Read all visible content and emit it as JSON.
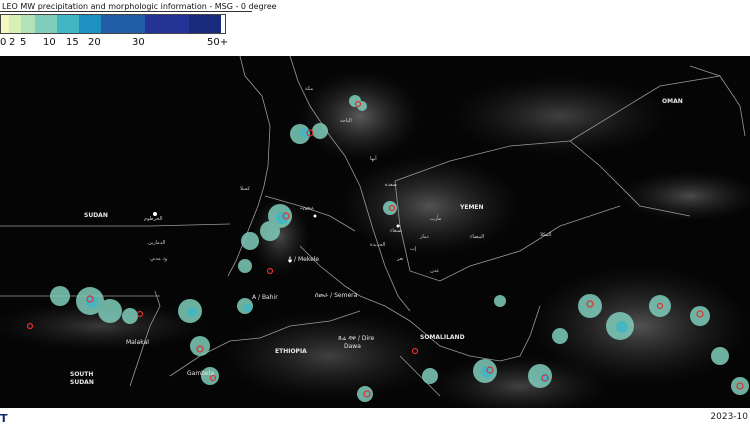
{
  "header": {
    "title": "LEO MW precipitation and morphologic information - MSG - 0 degree"
  },
  "legend": {
    "ticks": [
      "0",
      "2",
      "5",
      "10",
      "15",
      "20",
      "30",
      "50+"
    ],
    "colors": [
      "#f3f8c4",
      "#d8efb5",
      "#b2e2b8",
      "#7fcdbb",
      "#41b6c4",
      "#1d91c0",
      "#225ea8",
      "#253494",
      "#1a2a7a"
    ]
  },
  "map": {
    "countries": {
      "sudan": "SUDAN",
      "south_sudan_line1": "SOUTH",
      "south_sudan_line2": "SUDAN",
      "yemen": "YEMEN",
      "oman": "OMAN",
      "ethiopia": "ETHIOPIA",
      "somaliland": "SOMALILAND"
    },
    "cities": {
      "khartoum": "الخرطوم",
      "mecca": "مكة",
      "sanaa": "صنعاء",
      "asmara": "ኣስመራ",
      "mekele": "A / Mekele",
      "addis": "ADD / Addis",
      "semera": "ሰመራ / Semera",
      "dire_dawa_1": "ድሬ ዳዋ / Dire",
      "dire_dawa_2": "Dawa",
      "malakal": "Malakal",
      "gambela": "Gambela",
      "gondar": "A / Bahir",
      "sennar": "الدمازين",
      "taiz": "تعز",
      "aden": "عدن",
      "ibb": "إب",
      "mukalla": "المكلا",
      "hodeidah": "الحديدة",
      "marib": "مأرب",
      "saada": "صعدة",
      "albaha": "الباحة",
      "kassala": "كسلا",
      "abha": "أبها",
      "wadmadani": "ود مدني",
      "dhamar": "ذمار",
      "bayda": "البيضاء"
    }
  },
  "footer": {
    "logo": "T",
    "date": "2023-10"
  }
}
